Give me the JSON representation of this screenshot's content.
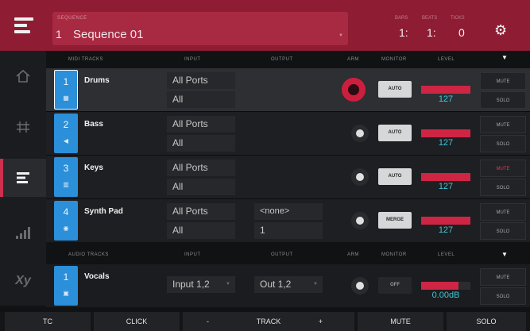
{
  "header": {
    "sequence_label": "SEQUENCE",
    "sequence_number": "1",
    "sequence_name": "Sequence 01",
    "time_labels": [
      "BARS",
      "BEATS",
      "TICKS"
    ],
    "bars": "1:",
    "beats": "1:",
    "ticks": "0"
  },
  "midi_columns": {
    "tracks": "MIDI TRACKS",
    "input": "INPUT",
    "output": "OUTPUT",
    "arm": "ARM",
    "monitor": "MONITOR",
    "level": "LEVEL"
  },
  "audio_columns": {
    "tracks": "AUDIO TRACKS",
    "input": "INPUT",
    "output": "OUTPUT",
    "arm": "ARM",
    "monitor": "MONITOR",
    "level": "LEVEL"
  },
  "midi_tracks": [
    {
      "number": "1",
      "name": "Drums",
      "icon": "drum-pads-icon",
      "input_port": "All Ports",
      "input_channel": "All",
      "output_port": "",
      "output_channel": "",
      "armed": true,
      "monitor": "AUTO",
      "level": "127",
      "level_fraction": 1.0,
      "mute": "MUTE",
      "solo": "SOLO",
      "mute_active": false
    },
    {
      "number": "2",
      "name": "Bass",
      "icon": "bass-icon",
      "input_port": "All Ports",
      "input_channel": "All",
      "output_port": "",
      "output_channel": "",
      "armed": false,
      "monitor": "AUTO",
      "level": "127",
      "level_fraction": 1.0,
      "mute": "MUTE",
      "solo": "SOLO",
      "mute_active": false
    },
    {
      "number": "3",
      "name": "Keys",
      "icon": "keys-icon",
      "input_port": "All Ports",
      "input_channel": "All",
      "output_port": "",
      "output_channel": "",
      "armed": false,
      "monitor": "AUTO",
      "level": "127",
      "level_fraction": 1.0,
      "mute": "MUTE",
      "solo": "SOLO",
      "mute_active": true
    },
    {
      "number": "4",
      "name": "Synth Pad",
      "icon": "synth-icon",
      "input_port": "All Ports",
      "input_channel": "All",
      "output_port": "<none>",
      "output_channel": "1",
      "armed": false,
      "monitor": "MERGE",
      "level": "127",
      "level_fraction": 1.0,
      "mute": "MUTE",
      "solo": "SOLO",
      "mute_active": false
    }
  ],
  "audio_tracks": [
    {
      "number": "1",
      "name": "Vocals",
      "icon": "audio-icon",
      "input": "Input 1,2",
      "output": "Out 1,2",
      "armed": false,
      "monitor": "OFF",
      "level": "0.00dB",
      "level_fraction": 0.75,
      "mute": "MUTE",
      "solo": "SOLO"
    }
  ],
  "bottom_bar": {
    "tc": "TC",
    "click": "CLICK",
    "track_minus": "-",
    "track": "TRACK",
    "track_plus": "+",
    "mute": "MUTE",
    "solo": "SOLO"
  },
  "colors": {
    "header": "#8e1c33",
    "track_blue": "#2b8fd9",
    "armed_red": "#cc1f3e",
    "level_red": "#cf2544",
    "level_text": "#3fc7d8"
  }
}
